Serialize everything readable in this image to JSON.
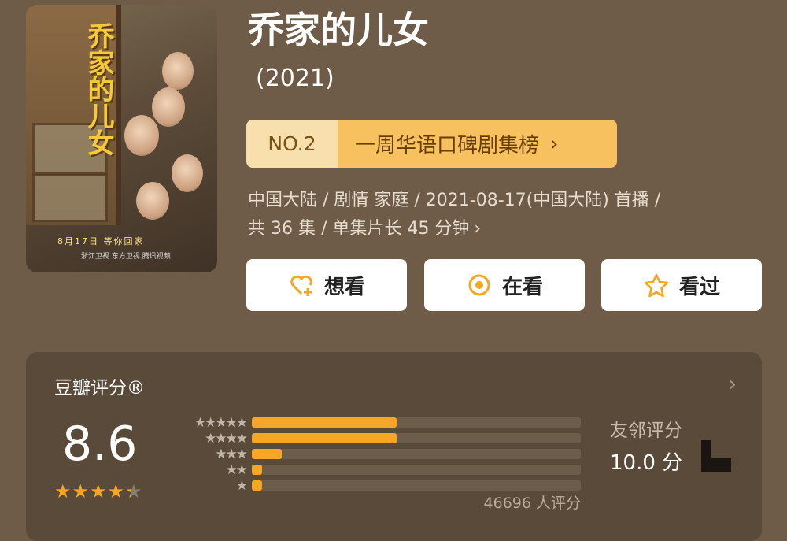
{
  "movie": {
    "title": "乔家的儿女",
    "year": "(2021)",
    "poster": {
      "title_text": "乔家的儿女",
      "date_text": "8月17日  等你回家",
      "logos_text": "浙江卫视  东方卫视  腾讯视频"
    },
    "ranking": {
      "rank": "NO.2",
      "list_name": "一周华语口碑剧集榜",
      "arrow": "›"
    },
    "meta_line1": "中国大陆 / 剧情 家庭 / 2021-08-17(中国大陆) 首播 /",
    "meta_line2": "共 36 集 / 单集片长 45 分钟",
    "meta_chevron": "›"
  },
  "actions": [
    {
      "label": "想看",
      "icon": "heart-plus-icon"
    },
    {
      "label": "在看",
      "icon": "target-circle-icon"
    },
    {
      "label": "看过",
      "icon": "star-outline-icon"
    }
  ],
  "rating": {
    "header": "豆瓣评分®",
    "chevron": "›",
    "score": "8.6",
    "stars_display": "★★★★★",
    "stars_value": 4.3,
    "distribution": [
      {
        "stars": "★★★★★",
        "fraction": 0.44
      },
      {
        "stars": "★★★★",
        "fraction": 0.44
      },
      {
        "stars": "★★★",
        "fraction": 0.09
      },
      {
        "stars": "★★",
        "fraction": 0.03
      },
      {
        "stars": "★",
        "fraction": 0.03
      }
    ],
    "count": "46696 人评分",
    "friend_label": "友邻评分",
    "friend_score": "10.0 分"
  },
  "colors": {
    "background": "#6e5b48",
    "accent": "#f5a623",
    "rank_left": "#f8dfae",
    "rank_right": "#f7c15f"
  }
}
